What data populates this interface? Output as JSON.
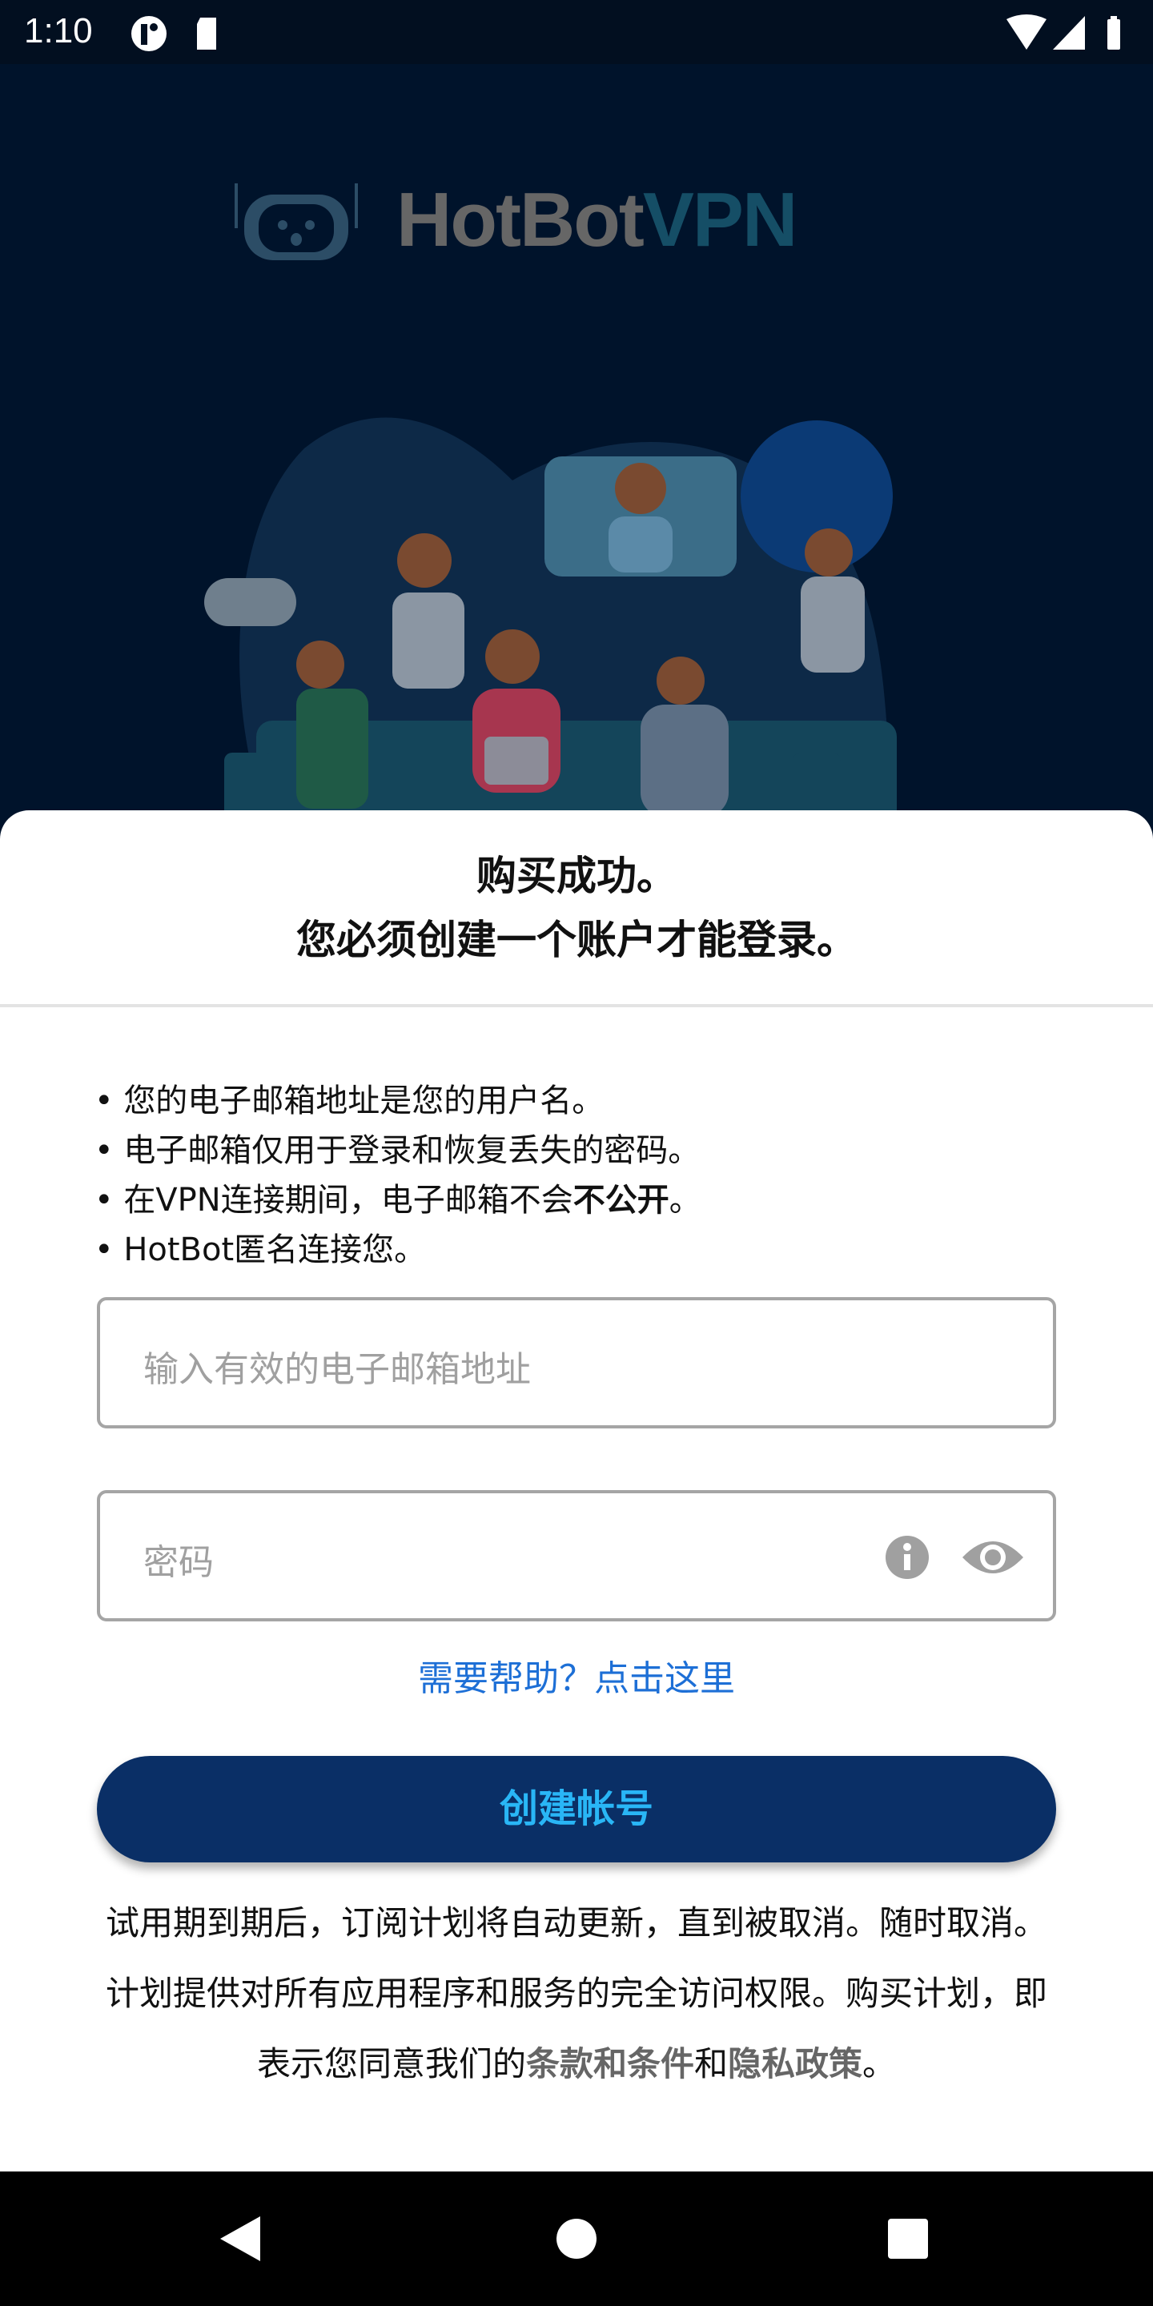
{
  "status_bar": {
    "time": "1:10",
    "icons": [
      "notification-app-icon",
      "sd-card-icon",
      "wifi-icon",
      "signal-icon",
      "battery-icon"
    ]
  },
  "logo": {
    "part1": "HotBot",
    "part2": "VPN",
    "color1": "#666666",
    "color2": "#154e66"
  },
  "sheet": {
    "title_line1": "购买成功。",
    "title_line2": "您必须创建一个账户才能登录。",
    "bullets": [
      "您的电子邮箱地址是您的用户名。",
      "电子邮箱仅用于登录和恢复丢失的密码。",
      "在VPN连接期间，电子邮箱不会",
      "HotBot匿名连接您。"
    ],
    "bullet3_bold": "不公开",
    "bullet3_end": "。",
    "email_placeholder": "输入有效的电子邮箱地址",
    "password_placeholder": "密码",
    "help_link": "需要帮助？点击这里",
    "create_button": "创建帐号",
    "terms_text": "试用期到期后，订阅计划将自动更新，直到被取消。随时取消。计划提供对所有应用程序和服务的完全访问权限。购买计划，即表示您同意我们的",
    "terms_link": "条款和条件",
    "terms_and": "和",
    "privacy_link": "隐私政策",
    "terms_end": "。"
  },
  "colors": {
    "button_bg": "#0a2f66",
    "button_text": "#29b6f6",
    "link": "#1d6fd6"
  }
}
